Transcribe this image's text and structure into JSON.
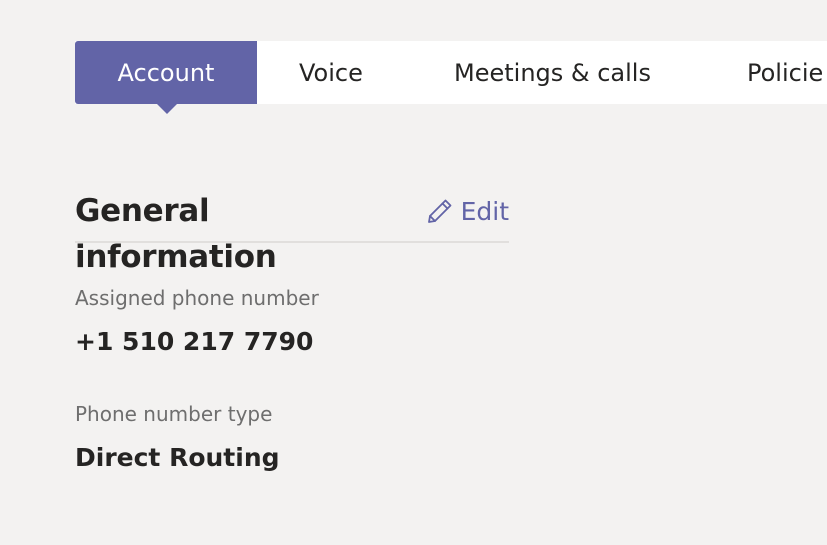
{
  "tabs": [
    {
      "label": "Account",
      "active": true
    },
    {
      "label": "Voice",
      "active": false
    },
    {
      "label": "Meetings & calls",
      "active": false
    },
    {
      "label": "Policie",
      "active": false
    }
  ],
  "section": {
    "title": "General information",
    "edit_label": "Edit",
    "edit_icon": "pencil-icon"
  },
  "fields": [
    {
      "label": "Assigned phone number",
      "value": "+1 510 217 7790"
    },
    {
      "label": "Phone number type",
      "value": "Direct Routing"
    }
  ],
  "colors": {
    "accent": "#6264a7",
    "background": "#f3f2f1",
    "tabbar": "#ffffff",
    "label": "#6e6e6e",
    "text": "#252423",
    "divider": "#e1dfdd"
  }
}
